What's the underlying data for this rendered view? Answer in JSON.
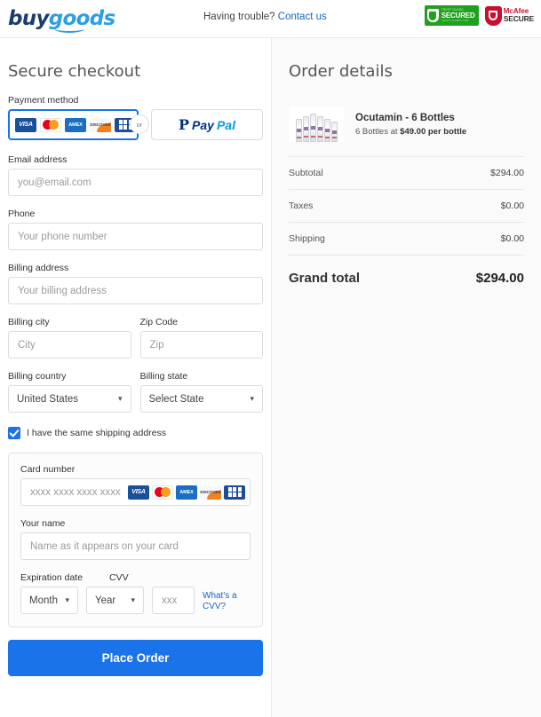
{
  "header": {
    "logo_primary": "buy",
    "logo_secondary": "goods",
    "help_text": "Having trouble?",
    "help_link": "Contact us",
    "badges": {
      "trust": {
        "top": "TRUST GUARD",
        "main": "SECURED",
        "bottom": "TRUST-GUARD.COM"
      },
      "mcafee": {
        "line1": "McAfee",
        "line2": "SECURE"
      }
    }
  },
  "checkout": {
    "title": "Secure checkout",
    "payment_method": {
      "label": "Payment method",
      "or_label": "or",
      "cards": [
        "VISA",
        "Mastercard",
        "AMEX",
        "DISCOVER",
        "JCB"
      ],
      "card_labels": {
        "visa": "VISA",
        "amex": "AMEX",
        "discover": "DISCOVER"
      },
      "paypal": {
        "pay": "Pay",
        "pal": "Pal"
      }
    },
    "email": {
      "label": "Email address",
      "value": "",
      "placeholder": "you@email.com"
    },
    "phone": {
      "label": "Phone",
      "value": "",
      "placeholder": "Your phone number"
    },
    "billing_address": {
      "label": "Billing address",
      "value": "",
      "placeholder": "Your billing address"
    },
    "billing_city": {
      "label": "Billing city",
      "value": "",
      "placeholder": "City"
    },
    "zip_code": {
      "label": "Zip Code",
      "value": "",
      "placeholder": "Zip"
    },
    "billing_country": {
      "label": "Billing country",
      "value": "United States"
    },
    "billing_state": {
      "label": "Billing state",
      "value": "Select State"
    },
    "same_shipping": {
      "label": "I have the same shipping address",
      "checked": true
    },
    "card_number": {
      "label": "Card number",
      "value": "",
      "placeholder": "xxxx xxxx xxxx xxxx"
    },
    "your_name": {
      "label": "Your name",
      "value": "",
      "placeholder": "Name as it appears on your card"
    },
    "expiration": {
      "label": "Expiration date",
      "month": "Month",
      "year": "Year"
    },
    "cvv": {
      "label": "CVV",
      "value": "",
      "placeholder": "xxx",
      "help_link": "What's a CVV?"
    },
    "place_order": "Place Order"
  },
  "order": {
    "title": "Order details",
    "product": {
      "name": "Ocutamin - 6 Bottles",
      "detail_prefix": "6 Bottles at ",
      "detail_price": "$49.00",
      "detail_suffix": " per bottle"
    },
    "rows": [
      {
        "label": "Subtotal",
        "value": "$294.00"
      },
      {
        "label": "Taxes",
        "value": "$0.00"
      },
      {
        "label": "Shipping",
        "value": "$0.00"
      }
    ],
    "grand_total": {
      "label": "Grand total",
      "value": "$294.00"
    }
  },
  "colors": {
    "accent_blue": "#1a73e8",
    "link_blue": "#1565c0",
    "panel_bg": "#fafafa",
    "trust_green": "#1fa11f",
    "mcafee_red": "#c8102e"
  }
}
